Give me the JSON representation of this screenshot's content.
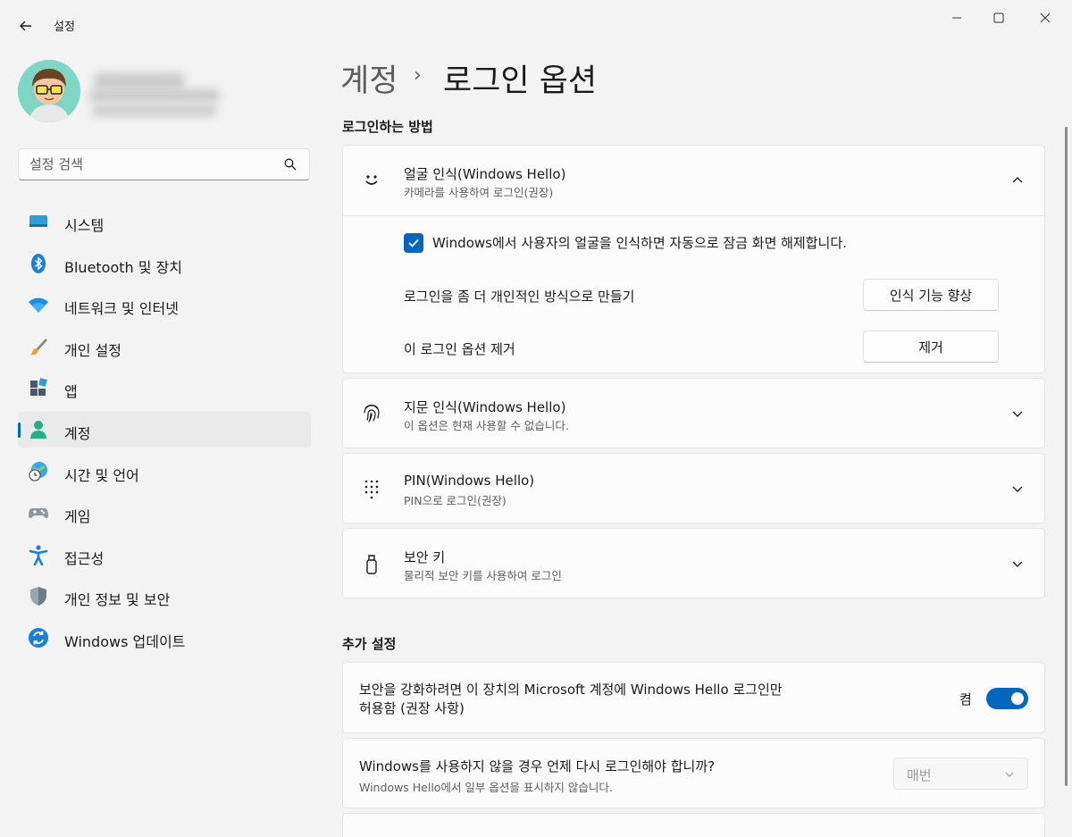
{
  "window": {
    "title": "설정",
    "controls": [
      "minimize-icon",
      "maximize-icon",
      "close-icon"
    ]
  },
  "search": {
    "placeholder": "설정 검색"
  },
  "sidebar": {
    "items": [
      {
        "label": "시스템",
        "icon": "system-icon"
      },
      {
        "label": "Bluetooth 및 장치",
        "icon": "bluetooth-icon"
      },
      {
        "label": "네트워크 및 인터넷",
        "icon": "wifi-icon"
      },
      {
        "label": "개인 설정",
        "icon": "brush-icon"
      },
      {
        "label": "앱",
        "icon": "apps-icon"
      },
      {
        "label": "계정",
        "icon": "account-icon",
        "active": true
      },
      {
        "label": "시간 및 언어",
        "icon": "time-language-icon"
      },
      {
        "label": "게임",
        "icon": "gamepad-icon"
      },
      {
        "label": "접근성",
        "icon": "accessibility-icon"
      },
      {
        "label": "개인 정보 및 보안",
        "icon": "shield-icon"
      },
      {
        "label": "Windows 업데이트",
        "icon": "update-icon"
      }
    ]
  },
  "header": {
    "parent": "계정",
    "separator": "›",
    "current": "로그인 옵션"
  },
  "signin": {
    "section_title": "로그인하는 방법",
    "face": {
      "title": "얼굴 인식(Windows Hello)",
      "subtitle": "카메라를 사용하여 로그인(권장)",
      "checkbox_label": "Windows에서 사용자의 얼굴을 인식하면 자동으로 잠금 화면 해제합니다.",
      "checkbox_checked": true,
      "improve_label": "로그인을 좀 더 개인적인 방식으로 만들기",
      "improve_button": "인식 기능 향상",
      "remove_label": "이 로그인 옵션 제거",
      "remove_button": "제거"
    },
    "fingerprint": {
      "title": "지문 인식(Windows Hello)",
      "subtitle": "이 옵션은 현재 사용할 수 없습니다."
    },
    "pin": {
      "title": "PIN(Windows Hello)",
      "subtitle": "PIN으로 로그인(권장)"
    },
    "security_key": {
      "title": "보안 키",
      "subtitle": "물리적 보안 키를 사용하여 로그인"
    }
  },
  "additional": {
    "section_title": "추가 설정",
    "hello_only": {
      "line1": "보안을 강화하려면 이 장치의 Microsoft 계정에 Windows Hello 로그인만",
      "line2": "허용함 (권장 사항)",
      "state": "켬",
      "on": true
    },
    "relogin": {
      "title": "Windows를 사용하지 않을 경우 언제 다시 로그인해야 합니까?",
      "subtitle": "Windows Hello에서 일부 옵션을 표시하지 않습니다.",
      "value": "매번"
    }
  },
  "colors": {
    "accent": "#0067c0",
    "background": "#f3f3f3",
    "card": "#fbfbfb"
  }
}
